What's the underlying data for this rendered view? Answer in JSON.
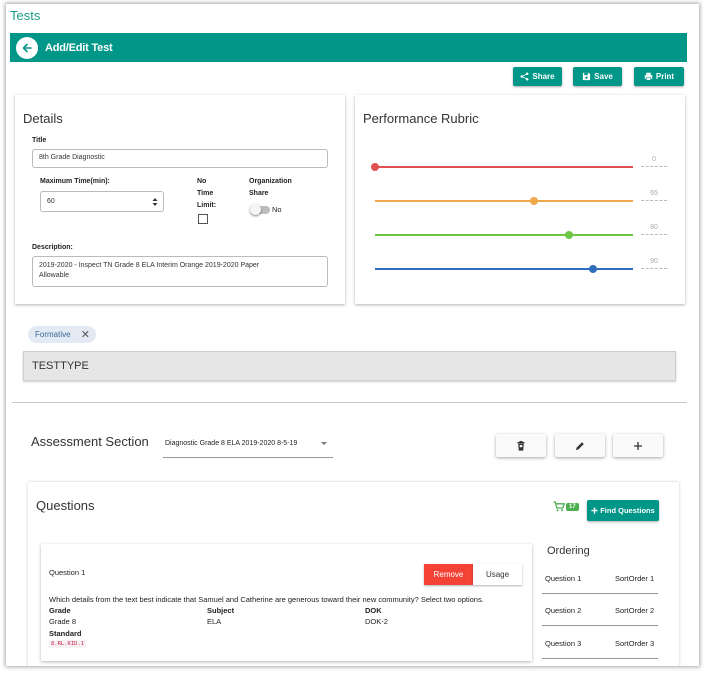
{
  "page": {
    "title": "Tests"
  },
  "header": {
    "title": "Add/Edit Test"
  },
  "toolbar": {
    "share_label": "Share",
    "save_label": "Save",
    "print_label": "Print"
  },
  "details": {
    "heading": "Details",
    "title_label": "Title",
    "title_value": "8th Grade Diagnostic",
    "max_time_label": "Maximum Time(min):",
    "max_time_value": "60",
    "no_time_limit_label_1": "No",
    "no_time_limit_label_2": "Time",
    "no_time_limit_label_3": "Limit:",
    "no_time_limit_checked": false,
    "org_share_label_1": "Organization",
    "org_share_label_2": "Share",
    "org_share_value": "No",
    "description_label": "Description:",
    "description_line_1": "2019-2020 - Inspect TN Grade 8 ELA Interim Orange 2019-2020 Paper",
    "description_line_2": "Allowable"
  },
  "rubric": {
    "heading": "Performance Rubric",
    "levels": [
      {
        "value": "0",
        "color": "#e05252",
        "position": 0
      },
      {
        "value": "65",
        "color": "#f0a84a",
        "position": 0.65
      },
      {
        "value": "80",
        "color": "#6cc644",
        "position": 0.8
      },
      {
        "value": "90",
        "color": "#2f6ebc",
        "position": 0.9
      }
    ]
  },
  "tags": {
    "chip_label": "Formative",
    "test_type": "TESTTYPE"
  },
  "assessment": {
    "label": "Assessment Section",
    "selected": "Diagnostic Grade 8 ELA 2019-2020 8-5-19"
  },
  "questions": {
    "heading": "Questions",
    "cart_count": "17",
    "find_label": "Find Questions",
    "items": [
      {
        "name": "Question 1",
        "remove_label": "Remove",
        "usage_label": "Usage",
        "text": "Which details from the text best indicate that Samuel and Catherine are generous toward their new community?  Select two options.",
        "grade_label": "Grade",
        "grade": "Grade 8",
        "subject_label": "Subject",
        "subject": "ELA",
        "dok_label": "DOK",
        "dok": "DOK-2",
        "standard_label": "Standard",
        "standard": "8.RL.KID.1"
      }
    ]
  },
  "ordering": {
    "heading": "Ordering",
    "rows": [
      {
        "question": "Question 1",
        "sort": "SortOrder 1"
      },
      {
        "question": "Question 2",
        "sort": "SortOrder 2"
      },
      {
        "question": "Question 3",
        "sort": "SortOrder 3"
      }
    ]
  },
  "colors": {
    "accent": "#009688",
    "page_title": "#1a9d8a",
    "remove": "#f44336",
    "cart": "#4caf50"
  },
  "icons": [
    "back-arrow-icon",
    "share-icon",
    "save-icon",
    "print-icon",
    "close-icon",
    "delete-icon",
    "edit-icon",
    "add-icon",
    "cart-icon",
    "plus-icon",
    "caret-down-icon"
  ]
}
